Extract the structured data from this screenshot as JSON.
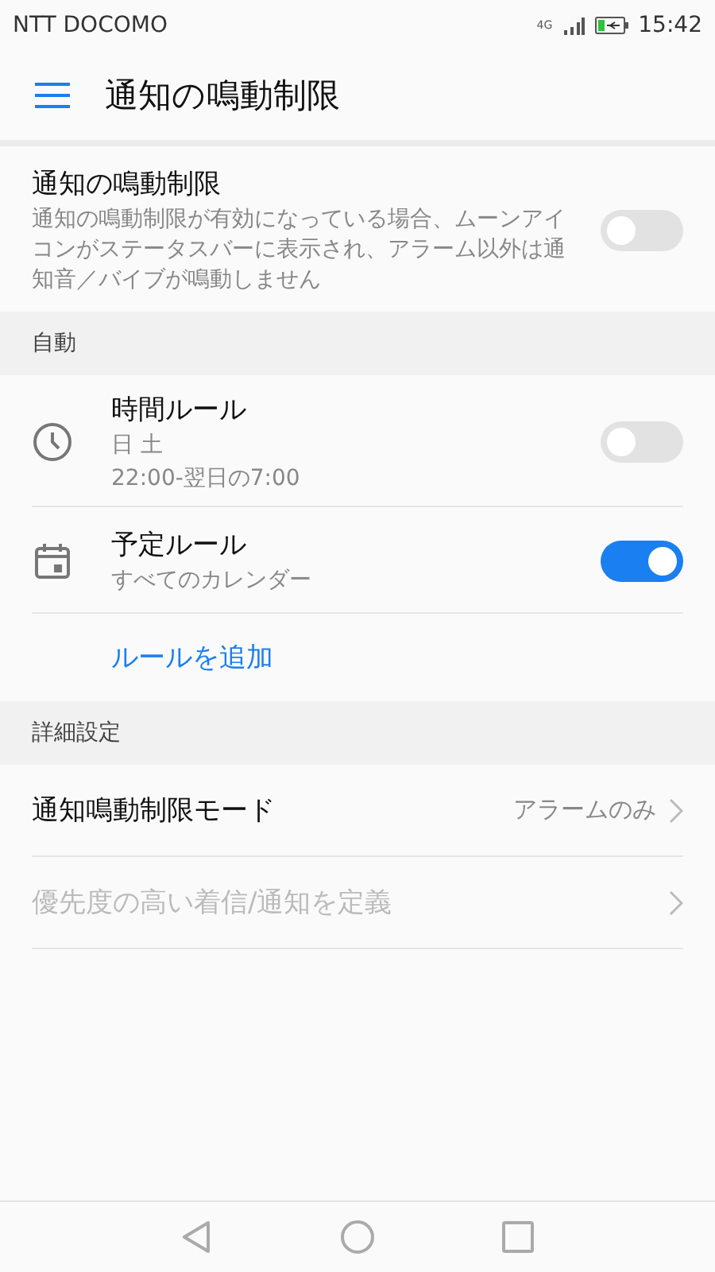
{
  "status_bar": {
    "carrier": "NTT DOCOMO",
    "network_type": "4G",
    "time": "15:42"
  },
  "app_bar": {
    "title": "通知の鳴動制限"
  },
  "main_toggle": {
    "title": "通知の鳴動制限",
    "description": "通知の鳴動制限が有効になっている場合、ムーンアイコンがステータスバーに表示され、アラーム以外は通知音／バイブが鳴動しません",
    "on": false
  },
  "sections": [
    {
      "header": "自動",
      "items": [
        {
          "kind": "rule",
          "title": "時間ルール",
          "lines": [
            "日 土",
            "22:00-翌日の7:00"
          ],
          "on": false
        },
        {
          "kind": "rule",
          "title": "予定ルール",
          "lines": [
            "すべてのカレンダー"
          ],
          "on": true
        },
        {
          "kind": "link",
          "title": "ルールを追加"
        }
      ]
    },
    {
      "header": "詳細設定",
      "items": [
        {
          "kind": "nav",
          "title": "通知鳴動制限モード",
          "value": "アラームのみ",
          "disabled": false
        },
        {
          "kind": "nav",
          "title": "優先度の高い着信/通知を定義",
          "disabled": true
        }
      ]
    }
  ]
}
